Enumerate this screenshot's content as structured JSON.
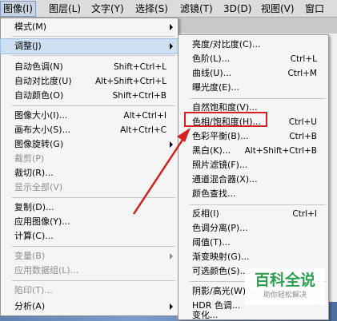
{
  "menubar": {
    "items": [
      "图像(I)",
      "图层(L)",
      "文字(Y)",
      "选择(S)",
      "滤镜(T)",
      "3D(D)",
      "视图(V)",
      "窗口"
    ]
  },
  "image_menu": {
    "items": [
      {
        "label": "模式(M)",
        "shortcut": "",
        "submenu": true,
        "disabled": false
      },
      {
        "label": "调整(J)",
        "shortcut": "",
        "submenu": true,
        "disabled": false,
        "highlighted": true
      },
      {
        "label": "自动色调(N)",
        "shortcut": "Shift+Ctrl+L"
      },
      {
        "label": "自动对比度(U)",
        "shortcut": "Alt+Shift+Ctrl+L"
      },
      {
        "label": "自动颜色(O)",
        "shortcut": "Shift+Ctrl+B"
      },
      {
        "label": "图像大小(I)...",
        "shortcut": "Alt+Ctrl+I"
      },
      {
        "label": "画布大小(S)...",
        "shortcut": "Alt+Ctrl+C"
      },
      {
        "label": "图像旋转(G)",
        "shortcut": "",
        "submenu": true
      },
      {
        "label": "裁剪(P)",
        "shortcut": "",
        "disabled": true
      },
      {
        "label": "裁切(R)...",
        "shortcut": ""
      },
      {
        "label": "显示全部(V)",
        "shortcut": "",
        "disabled": true
      },
      {
        "label": "复制(D)...",
        "shortcut": ""
      },
      {
        "label": "应用图像(Y)...",
        "shortcut": ""
      },
      {
        "label": "计算(C)...",
        "shortcut": ""
      },
      {
        "label": "变量(B)",
        "shortcut": "",
        "submenu": true,
        "disabled": true
      },
      {
        "label": "应用数据组(L)...",
        "shortcut": "",
        "disabled": true
      },
      {
        "label": "陷印(T)...",
        "shortcut": "",
        "disabled": true
      },
      {
        "label": "分析(A)",
        "shortcut": "",
        "submenu": true
      }
    ]
  },
  "adjust_menu": {
    "items": [
      {
        "label": "亮度/对比度(C)...",
        "shortcut": ""
      },
      {
        "label": "色阶(L)...",
        "shortcut": "Ctrl+L"
      },
      {
        "label": "曲线(U)...",
        "shortcut": "Ctrl+M"
      },
      {
        "label": "曝光度(E)...",
        "shortcut": ""
      },
      {
        "label": "自然饱和度(V)...",
        "shortcut": ""
      },
      {
        "label": "色相/饱和度(H)...",
        "shortcut": "Ctrl+U"
      },
      {
        "label": "色彩平衡(B)...",
        "shortcut": "Ctrl+B"
      },
      {
        "label": "黑白(K)...",
        "shortcut": "Alt+Shift+Ctrl+B"
      },
      {
        "label": "照片滤镜(F)...",
        "shortcut": ""
      },
      {
        "label": "通道混合器(X)...",
        "shortcut": ""
      },
      {
        "label": "颜色查找...",
        "shortcut": ""
      },
      {
        "label": "反相(I)",
        "shortcut": "Ctrl+I"
      },
      {
        "label": "色调分离(P)...",
        "shortcut": ""
      },
      {
        "label": "阈值(T)...",
        "shortcut": ""
      },
      {
        "label": "渐变映射(G)...",
        "shortcut": ""
      },
      {
        "label": "可选颜色(S)...",
        "shortcut": ""
      },
      {
        "label": "阴影/高光(W)...",
        "shortcut": ""
      },
      {
        "label": "HDR 色调...",
        "shortcut": ""
      },
      {
        "label": "变化...",
        "shortcut": ""
      }
    ]
  },
  "watermark": {
    "title": "百科全说",
    "subtitle": "助你轻松解决"
  },
  "colors": {
    "annotation_red": "#d42020",
    "watermark_green": "#2e9e4f"
  }
}
